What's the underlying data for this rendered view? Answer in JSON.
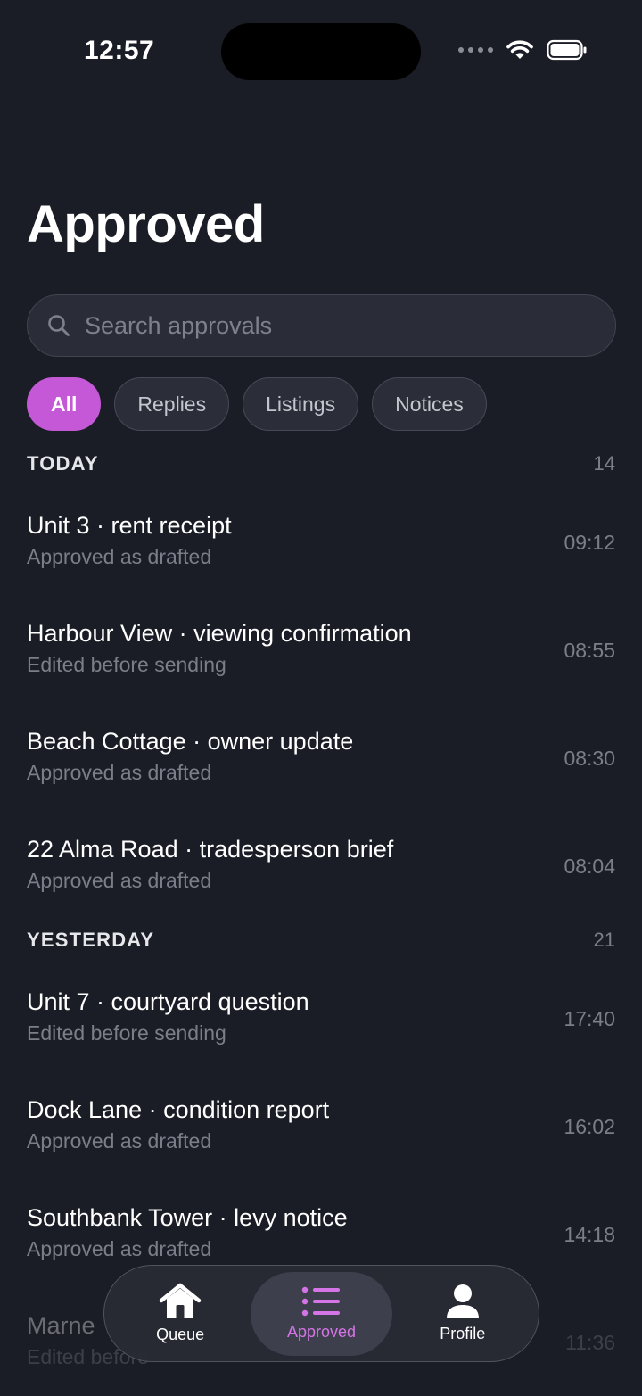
{
  "status_bar": {
    "time": "12:57"
  },
  "header": {
    "title": "Approved"
  },
  "search": {
    "placeholder": "Search approvals"
  },
  "filters": [
    {
      "label": "All",
      "active": true
    },
    {
      "label": "Replies",
      "active": false
    },
    {
      "label": "Listings",
      "active": false
    },
    {
      "label": "Notices",
      "active": false
    }
  ],
  "sections": [
    {
      "title": "TODAY",
      "count": "14",
      "items": [
        {
          "title": "Unit 3 · rent receipt",
          "subtitle": "Approved as drafted",
          "time": "09:12"
        },
        {
          "title": "Harbour View · viewing confirmation",
          "subtitle": "Edited before sending",
          "time": "08:55"
        },
        {
          "title": "Beach Cottage · owner update",
          "subtitle": "Approved as drafted",
          "time": "08:30"
        },
        {
          "title": "22 Alma Road · tradesperson brief",
          "subtitle": "Approved as drafted",
          "time": "08:04"
        }
      ]
    },
    {
      "title": "YESTERDAY",
      "count": "21",
      "items": [
        {
          "title": "Unit 7 · courtyard question",
          "subtitle": "Edited before sending",
          "time": "17:40"
        },
        {
          "title": "Dock Lane · condition report",
          "subtitle": "Approved as drafted",
          "time": "16:02"
        },
        {
          "title": "Southbank Tower · levy notice",
          "subtitle": "Approved as drafted",
          "time": "14:18"
        },
        {
          "title": "Marne",
          "subtitle": "Edited before",
          "time": "11:36"
        }
      ]
    }
  ],
  "tabbar": {
    "tabs": [
      {
        "label": "Queue",
        "icon": "house-icon",
        "active": false
      },
      {
        "label": "Approved",
        "icon": "list-icon",
        "active": true
      },
      {
        "label": "Profile",
        "icon": "person-icon",
        "active": false
      }
    ]
  },
  "colors": {
    "accent": "#c458d6",
    "background": "#1b1d26",
    "active_tab_label": "#d574e6"
  }
}
